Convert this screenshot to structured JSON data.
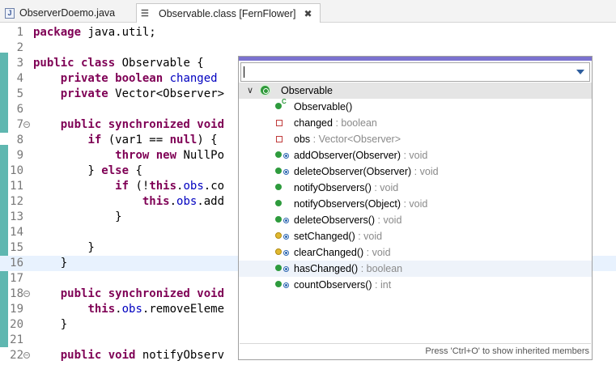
{
  "tabs": [
    {
      "label": "ObserverDoemo.java",
      "icon": "java-file-icon",
      "active": false
    },
    {
      "label": "Observable.class [FernFlower]",
      "icon": "class-file-icon",
      "active": true,
      "close": "✖"
    }
  ],
  "editor": {
    "lines": [
      {
        "n": "1",
        "html": "<span class=\"kw\">package</span> java.util;"
      },
      {
        "n": "2",
        "html": ""
      },
      {
        "n": "3",
        "html": "<span class=\"kw\">public class</span> Observable {"
      },
      {
        "n": "4",
        "html": "    <span class=\"kw\">private boolean</span> <span class=\"fld\">changed</span>"
      },
      {
        "n": "5",
        "html": "    <span class=\"kw\">private</span> Vector&lt;Observer&gt;"
      },
      {
        "n": "6",
        "html": ""
      },
      {
        "n": "7",
        "html": "    <span class=\"kw\">public synchronized void</span>",
        "fold": true
      },
      {
        "n": "8",
        "html": "        <span class=\"kw\">if</span> (var1 == <span class=\"kw\">null</span>) {"
      },
      {
        "n": "9",
        "html": "            <span class=\"kw\">throw new</span> NullPo"
      },
      {
        "n": "10",
        "html": "        } <span class=\"kw\">else</span> {"
      },
      {
        "n": "11",
        "html": "            <span class=\"kw\">if</span> (!<span class=\"kw\">this</span>.<span class=\"fld\">obs</span>.co"
      },
      {
        "n": "12",
        "html": "                <span class=\"kw\">this</span>.<span class=\"fld\">obs</span>.add"
      },
      {
        "n": "13",
        "html": "            }"
      },
      {
        "n": "14",
        "html": ""
      },
      {
        "n": "15",
        "html": "        }"
      },
      {
        "n": "16",
        "html": "    }",
        "current": true
      },
      {
        "n": "17",
        "html": ""
      },
      {
        "n": "18",
        "html": "    <span class=\"kw\">public synchronized void</span>",
        "fold": true
      },
      {
        "n": "19",
        "html": "        <span class=\"kw\">this</span>.<span class=\"fld\">obs</span>.removeEleme"
      },
      {
        "n": "20",
        "html": "    }"
      },
      {
        "n": "21",
        "html": ""
      },
      {
        "n": "22",
        "html": "    <span class=\"kw\">public void</span> notifyObserv",
        "fold": true
      }
    ]
  },
  "outline": {
    "root_label": "Observable",
    "footer": "Press 'Ctrl+O' to show inherited members",
    "members": [
      {
        "name": "Observable()",
        "type": "",
        "vis": "pub",
        "override": false,
        "constructor": true
      },
      {
        "name": "changed",
        "type": " : boolean",
        "vis": "priv",
        "override": false
      },
      {
        "name": "obs",
        "type": " : Vector<Observer>",
        "vis": "priv",
        "override": false
      },
      {
        "name": "addObserver(Observer)",
        "type": " : void",
        "vis": "pub",
        "override": true
      },
      {
        "name": "deleteObserver(Observer)",
        "type": " : void",
        "vis": "pub",
        "override": true
      },
      {
        "name": "notifyObservers()",
        "type": " : void",
        "vis": "pub",
        "override": false
      },
      {
        "name": "notifyObservers(Object)",
        "type": " : void",
        "vis": "pub",
        "override": false
      },
      {
        "name": "deleteObservers()",
        "type": " : void",
        "vis": "pub",
        "override": true
      },
      {
        "name": "setChanged()",
        "type": " : void",
        "vis": "prot",
        "override": true
      },
      {
        "name": "clearChanged()",
        "type": " : void",
        "vis": "prot",
        "override": true
      },
      {
        "name": "hasChanged()",
        "type": " : boolean",
        "vis": "pub",
        "override": true,
        "selected": true
      },
      {
        "name": "countObservers()",
        "type": " : int",
        "vis": "pub",
        "override": true
      }
    ]
  }
}
